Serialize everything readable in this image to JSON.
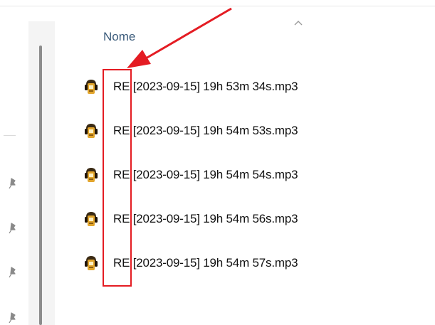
{
  "column_header": {
    "name_label": "Nome",
    "sort_icon": "chevron-up-icon"
  },
  "files": [
    {
      "name": "RE [2023-09-15] 19h 53m 34s.mp3",
      "icon": "audio-file-icon"
    },
    {
      "name": "RE [2023-09-15] 19h 54m 53s.mp3",
      "icon": "audio-file-icon"
    },
    {
      "name": "RE [2023-09-15] 19h 54m 54s.mp3",
      "icon": "audio-file-icon"
    },
    {
      "name": "RE [2023-09-15] 19h 54m 56s.mp3",
      "icon": "audio-file-icon"
    },
    {
      "name": "RE [2023-09-15] 19h 54m 57s.mp3",
      "icon": "audio-file-icon"
    }
  ],
  "nav_pane": {
    "pin_icon": "pin-icon",
    "pin_count": 4
  },
  "annotation": {
    "color": "#e41c23"
  }
}
